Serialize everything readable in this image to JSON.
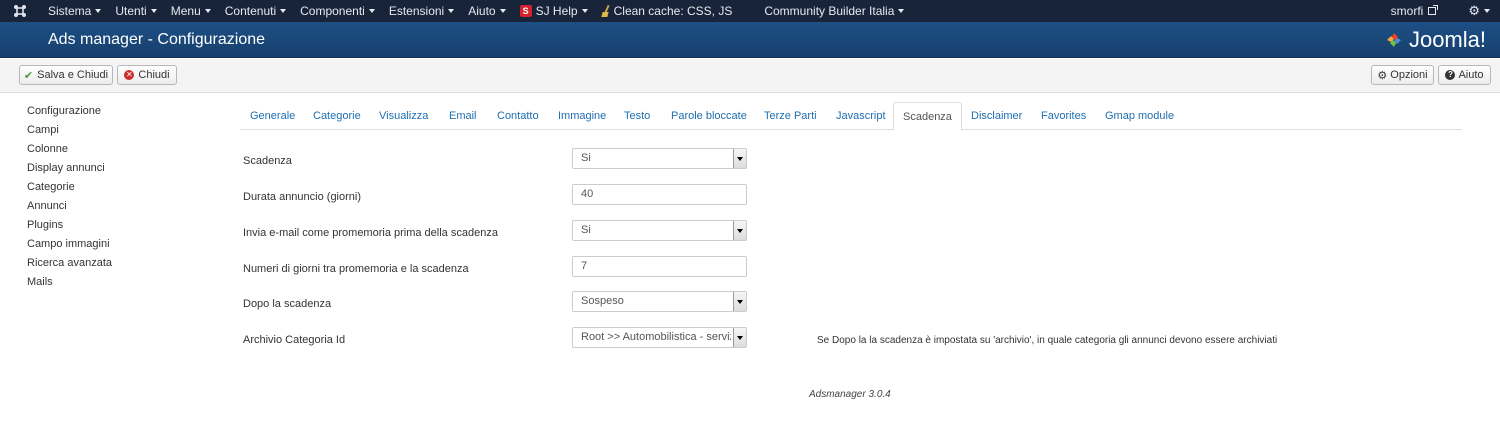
{
  "topbar": {
    "menus": [
      {
        "label": "Sistema"
      },
      {
        "label": "Utenti"
      },
      {
        "label": "Menu"
      },
      {
        "label": "Contenuti"
      },
      {
        "label": "Componenti"
      },
      {
        "label": "Estensioni"
      },
      {
        "label": "Aiuto"
      },
      {
        "label": "SJ Help"
      },
      {
        "label": "Clean cache: CSS, JS"
      },
      {
        "label": "Community Builder Italia"
      }
    ],
    "sj_badge": "S",
    "user": "smorfi",
    "icons": [
      "joomla-icon",
      "sj-help-icon",
      "broom-icon",
      "external-link-icon",
      "gear-icon"
    ]
  },
  "header": {
    "title": "Ads manager - Configurazione",
    "brand": "Joomla!"
  },
  "toolbar": {
    "save_close": "Salva e Chiudi",
    "close": "Chiudi",
    "options": "Opzioni",
    "help": "Aiuto"
  },
  "sidebar": {
    "items": [
      "Configurazione",
      "Campi",
      "Colonne",
      "Display annunci",
      "Categorie",
      "Annunci",
      "Plugins",
      "Campo immagini",
      "Ricerca avanzata",
      "Mails"
    ]
  },
  "tabs": {
    "items": [
      "Generale",
      "Categorie",
      "Visualizza",
      "Email",
      "Contatto",
      "Immagine",
      "Testo",
      "Parole bloccate",
      "Terze Parti",
      "Javascript",
      "Scadenza",
      "Disclaimer",
      "Favorites",
      "Gmap module"
    ],
    "active": "Scadenza"
  },
  "form": {
    "fields": [
      {
        "label": "Scadenza",
        "value": "Si"
      },
      {
        "label": "Durata annuncio (giorni)",
        "value": "40"
      },
      {
        "label": "Invia e-mail come promemoria prima della scadenza",
        "value": "Si"
      },
      {
        "label": "Numeri di giorni tra promemoria e la scadenza",
        "value": "7"
      },
      {
        "label": "Dopo la scadenza",
        "value": "Sospeso"
      },
      {
        "label": "Archivio Categoria Id",
        "value": "Root >> Automobilistica - serviz"
      }
    ],
    "help_text": "Se Dopo la la scadenza è impostata su 'archivio', in quale categoria gli annunci devono essere archiviati"
  },
  "footer": {
    "version": "Adsmanager 3.0.4"
  }
}
